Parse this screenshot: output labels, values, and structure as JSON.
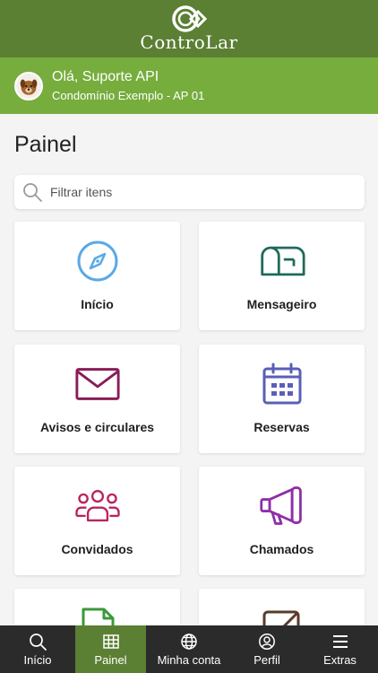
{
  "app": {
    "brand": "ControLar"
  },
  "user": {
    "greeting": "Olá, Suporte API",
    "unit": "Condomínio Exemplo - AP 01"
  },
  "page": {
    "title": "Painel"
  },
  "search": {
    "placeholder": "Filtrar itens",
    "value": ""
  },
  "menu": [
    {
      "label": "Início",
      "icon": "compass-icon",
      "color": "#5aa9e6"
    },
    {
      "label": "Mensageiro",
      "icon": "mailbox-icon",
      "color": "#1f6b5a"
    },
    {
      "label": "Avisos e circulares",
      "icon": "envelope-icon",
      "color": "#8a1c57"
    },
    {
      "label": "Reservas",
      "icon": "calendar-icon",
      "color": "#5a5fb6"
    },
    {
      "label": "Convidados",
      "icon": "users-icon",
      "color": "#b8255e"
    },
    {
      "label": "Chamados",
      "icon": "megaphone-icon",
      "color": "#8e2fa8"
    },
    {
      "label": "",
      "icon": "document-icon",
      "color": "#3a9a3a"
    },
    {
      "label": "",
      "icon": "edit-icon",
      "color": "#5a3a2a"
    }
  ],
  "bottom_nav": [
    {
      "label": "Início",
      "icon": "search-icon",
      "active": false
    },
    {
      "label": "Painel",
      "icon": "grid-icon",
      "active": true
    },
    {
      "label": "Minha conta",
      "icon": "globe-icon",
      "active": false
    },
    {
      "label": "Perfil",
      "icon": "profile-icon",
      "active": false
    },
    {
      "label": "Extras",
      "icon": "menu-icon",
      "active": false
    }
  ],
  "colors": {
    "header": "#5b7f33",
    "userbar": "#76ad3d",
    "nav": "#2b2b2b",
    "nav_active": "#5b7f33"
  }
}
